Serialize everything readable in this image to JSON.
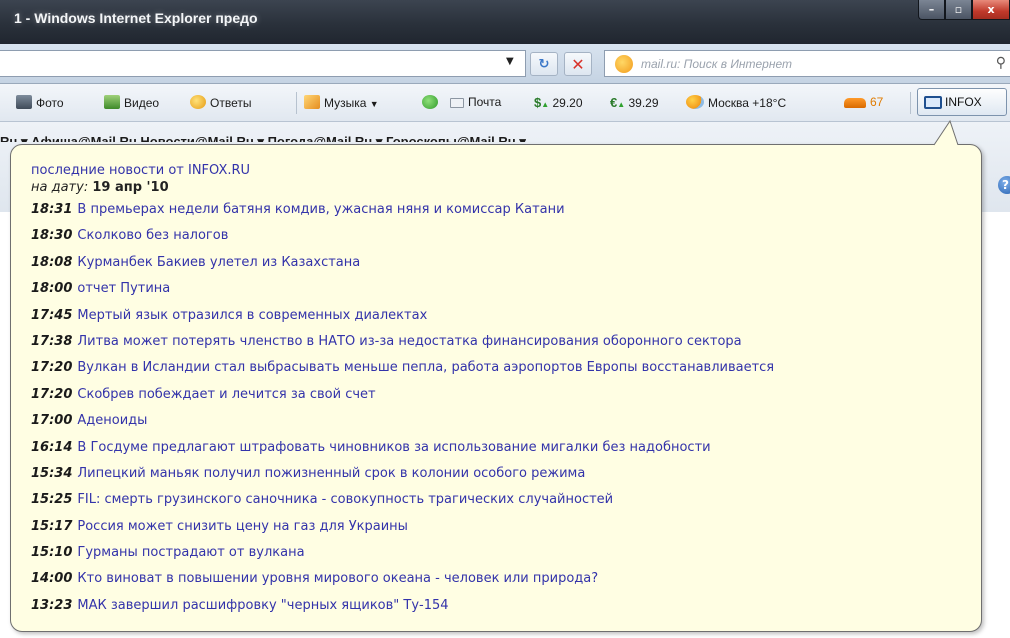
{
  "window": {
    "title": "1 - Windows Internet Explorer предо",
    "buttons": [
      "–",
      "▫",
      "x"
    ]
  },
  "address_bar": {
    "search_placeholder": "mail.ru: Поиск в Интернет"
  },
  "mail_toolbar": {
    "photo": "Фото",
    "video": "Видео",
    "answers": "Ответы",
    "music": "Музыка",
    "mail": "Почта",
    "usd": "29.20",
    "eur": "39.29",
    "weather": "Москва +18°C",
    "traffic": "67",
    "infox": "INFOX"
  },
  "links_bar": {
    "partial_text": "Ru ▾  Афиша@Mail.Ru  Новости@Mail.Ru ▾  Погода@Mail.Ru ▾  Гороскопы@Mail.Ru ▾"
  },
  "popup": {
    "header": "последние новости от INFOX.RU",
    "date_label": "на дату:",
    "date_value": "19 апр '10",
    "news": [
      {
        "time": "18:31",
        "title": "В премьерах недели батяня комдив, ужасная няня и комиссар Катани"
      },
      {
        "time": "18:30",
        "title": "Сколково без налогов"
      },
      {
        "time": "18:08",
        "title": "Курманбек Бакиев улетел из Казахстана"
      },
      {
        "time": "18:00",
        "title": "отчет Путина"
      },
      {
        "time": "17:45",
        "title": "Мертый язык отразился в современных диалектах"
      },
      {
        "time": "17:38",
        "title": "Литва может потерять членство в НАТО из-за недостатка финансирования оборонного сектора"
      },
      {
        "time": "17:20",
        "title": "Вулкан в Исландии стал выбрасывать меньше пепла, работа аэропортов Европы восстанавливается"
      },
      {
        "time": "17:20",
        "title": "Скобрев побеждает и лечится за свой счет"
      },
      {
        "time": "17:00",
        "title": "Аденоиды"
      },
      {
        "time": "16:14",
        "title": "В Госдуме предлагают штрафовать чиновников за использование мигалки без надобности"
      },
      {
        "time": "15:34",
        "title": "Липецкий маньяк получил пожизненный срок в колонии особого режима"
      },
      {
        "time": "15:25",
        "title": "FIL: смерть грузинского саночника - совокупность трагических случайностей"
      },
      {
        "time": "15:17",
        "title": "Россия может снизить цену на газ для Украины"
      },
      {
        "time": "15:10",
        "title": "Гурманы пострадают от вулкана"
      },
      {
        "time": "14:00",
        "title": "Кто виноват в повышении уровня мирового океана - человек или природа?"
      },
      {
        "time": "13:23",
        "title": "МАК завершил расшифровку \"черных ящиков\" Ту-154"
      }
    ]
  }
}
